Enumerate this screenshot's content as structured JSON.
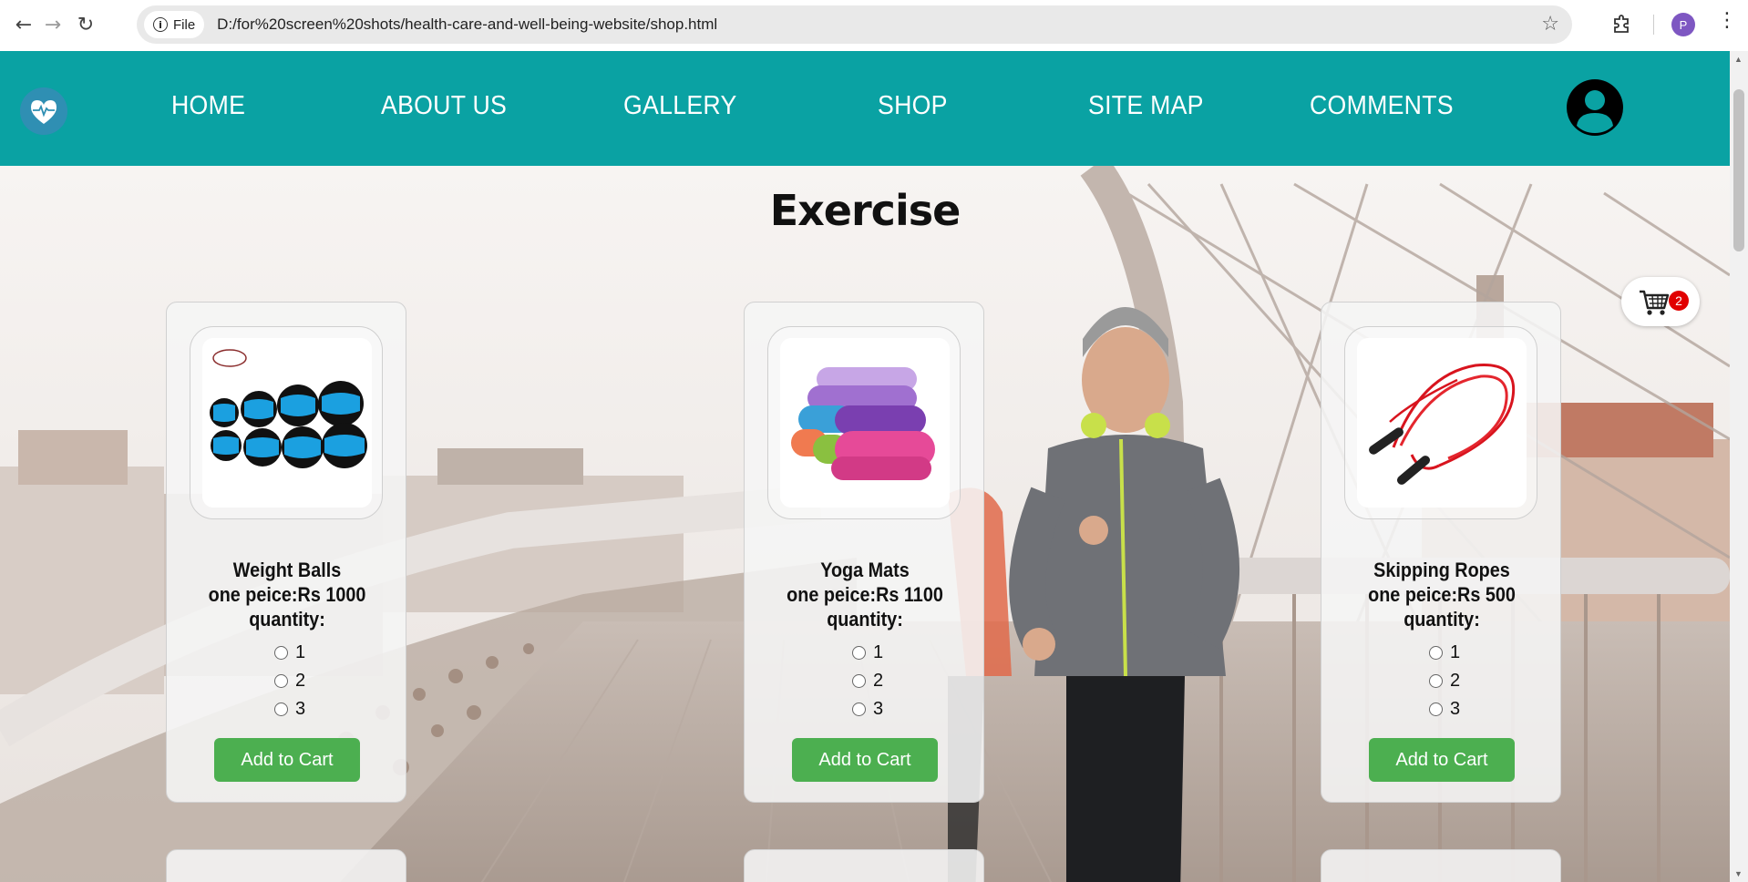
{
  "browser": {
    "file_label": "File",
    "url": "D:/for%20screen%20shots/health-care-and-well-being-website/shop.html",
    "profile_initial": "P"
  },
  "nav": {
    "items": [
      {
        "label": "HOME"
      },
      {
        "label": "ABOUT US"
      },
      {
        "label": "GALLERY"
      },
      {
        "label": "SHOP"
      },
      {
        "label": "SITE MAP"
      },
      {
        "label": "COMMENTS"
      }
    ]
  },
  "section": {
    "title": "Exercise"
  },
  "cart": {
    "count": "2"
  },
  "products": [
    {
      "name": "Weight Balls",
      "price": "one peice:Rs 1000",
      "qty_label": "quantity:",
      "options": [
        "1",
        "2",
        "3"
      ],
      "button": "Add to Cart"
    },
    {
      "name": "Yoga Mats",
      "price": "one peice:Rs 1100",
      "qty_label": "quantity:",
      "options": [
        "1",
        "2",
        "3"
      ],
      "button": "Add to Cart"
    },
    {
      "name": "Skipping Ropes",
      "price": "one peice:Rs 500",
      "qty_label": "quantity:",
      "options": [
        "1",
        "2",
        "3"
      ],
      "button": "Add to Cart"
    }
  ],
  "colors": {
    "header": "#0aa2a3",
    "button": "#4caf50",
    "badge": "#e10000"
  }
}
